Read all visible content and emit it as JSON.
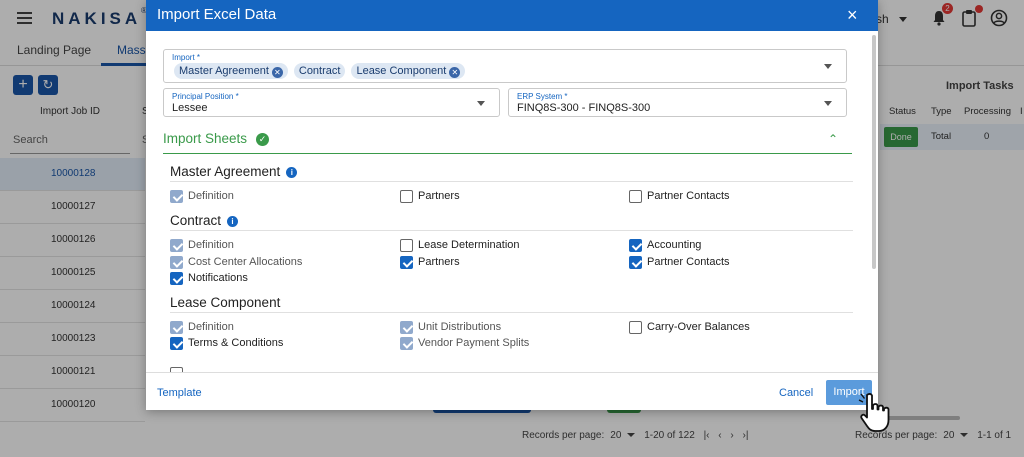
{
  "app": {
    "brand": "NAKISA",
    "brand_mark": "®",
    "language": "sh",
    "notification_count": "2"
  },
  "tabs": [
    {
      "label": "Landing Page"
    },
    {
      "label": "Mass"
    }
  ],
  "jobs_table": {
    "header_id": "Import Job ID",
    "header_second": "S",
    "search_placeholder": "Search",
    "search_placeholder_2": "S",
    "rows": [
      {
        "id": "10000128",
        "selected": true
      },
      {
        "id": "10000127",
        "selected": false
      },
      {
        "id": "10000126",
        "selected": false
      },
      {
        "id": "10000125",
        "selected": false
      },
      {
        "id": "10000124",
        "selected": false
      },
      {
        "id": "10000123",
        "selected": false
      },
      {
        "id": "10000121",
        "selected": false
      },
      {
        "id": "10000120",
        "selected": false
      }
    ],
    "records_per_page_label": "Records per page:",
    "records_per_page": "20",
    "range": "1-20 of 122"
  },
  "import_tasks": {
    "title": "Import Tasks",
    "headers": {
      "status": "Status",
      "type": "Type",
      "processing": "Processing",
      "extra": "I"
    },
    "row": {
      "status": "Done",
      "type": "Total",
      "processing": "0"
    },
    "records_per_page_label": "Records per page:",
    "records_per_page": "20",
    "range": "1-1 of 1"
  },
  "dialog": {
    "title": "Import Excel Data",
    "close_icon": "×",
    "import_field": {
      "label": "Import *",
      "chips": [
        "Master Agreement",
        "Contract",
        "Lease Component"
      ]
    },
    "principal_field": {
      "label": "Principal Position *",
      "value": "Lessee"
    },
    "erp_field": {
      "label": "ERP System *",
      "value": "FINQ8S-300 - FINQ8S-300"
    },
    "sheets_title": "Import Sheets",
    "sections": [
      {
        "title": "Master Agreement",
        "options": [
          {
            "label": "Definition",
            "state": "disabled"
          },
          {
            "label": "Partners",
            "state": "off"
          },
          {
            "label": "Partner Contacts",
            "state": "off"
          }
        ]
      },
      {
        "title": "Contract",
        "options": [
          {
            "label": "Definition",
            "state": "disabled"
          },
          {
            "label": "Lease Determination",
            "state": "off"
          },
          {
            "label": "Accounting",
            "state": "on"
          },
          {
            "label": "Cost Center Allocations",
            "state": "disabled"
          },
          {
            "label": "Partners",
            "state": "on"
          },
          {
            "label": "Partner Contacts",
            "state": "on"
          },
          {
            "label": "Notifications",
            "state": "on"
          }
        ]
      },
      {
        "title": "Lease Component",
        "options": [
          {
            "label": "Definition",
            "state": "disabled"
          },
          {
            "label": "Unit Distributions",
            "state": "disabled"
          },
          {
            "label": "Carry-Over Balances",
            "state": "off"
          },
          {
            "label": "Terms & Conditions",
            "state": "on"
          },
          {
            "label": "Vendor Payment Splits",
            "state": "disabled"
          }
        ]
      }
    ],
    "template_label": "Template",
    "cancel_label": "Cancel",
    "import_label": "Import"
  },
  "colors": {
    "primary": "#1565c0",
    "success": "#3a9a4a",
    "alert": "#e53935"
  }
}
